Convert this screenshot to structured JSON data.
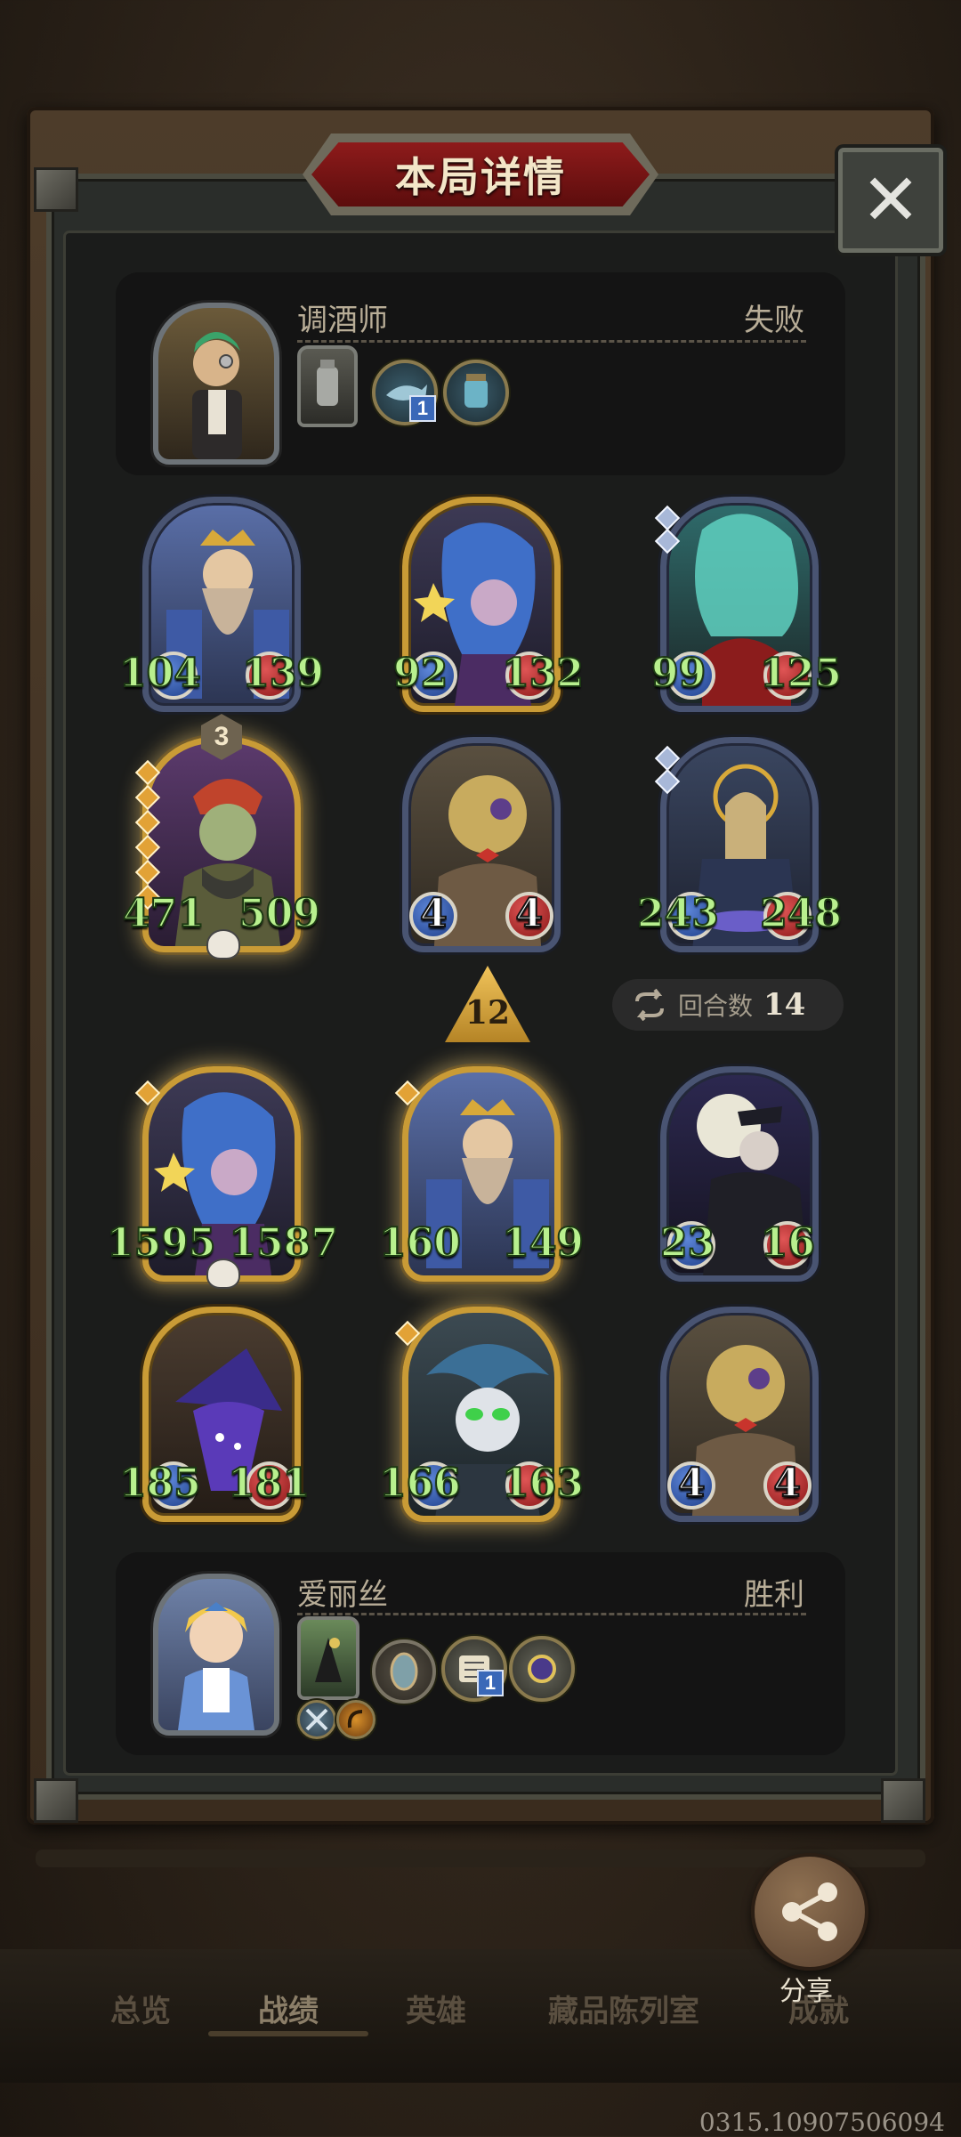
{
  "dialog": {
    "title": "本局详情"
  },
  "opponent": {
    "name": "调酒师",
    "result": "失败",
    "item_levels": [
      "1"
    ]
  },
  "opponent_board": [
    {
      "attack": "104",
      "health": "139"
    },
    {
      "attack": "92",
      "health": "132"
    },
    {
      "attack": "99",
      "health": "125"
    },
    {
      "attack": "471",
      "health": "509",
      "tier": "3"
    },
    {
      "attack": "4",
      "health": "4"
    },
    {
      "attack": "243",
      "health": "248"
    }
  ],
  "battle": {
    "turn_marker": "12",
    "rounds_label": "回合数",
    "rounds_value": "14"
  },
  "player_board": [
    {
      "attack": "1595",
      "health": "1587"
    },
    {
      "attack": "160",
      "health": "149"
    },
    {
      "attack": "23",
      "health": "16"
    },
    {
      "attack": "185",
      "health": "181"
    },
    {
      "attack": "166",
      "health": "163"
    },
    {
      "attack": "4",
      "health": "4"
    }
  ],
  "player": {
    "name": "爱丽丝",
    "result": "胜利",
    "item_levels": [
      "1"
    ]
  },
  "share": {
    "label": "分享"
  },
  "nav": {
    "items": [
      "总览",
      "战绩",
      "英雄",
      "藏品陈列室",
      "成就"
    ]
  },
  "build_id": "0315.10907506094",
  "icons": {
    "close": "close-icon",
    "share": "share-icon",
    "rounds": "swap-arrows-icon"
  },
  "colors": {
    "stat_green": "#b8f08e",
    "gold_border": "#c99b36",
    "banner_red": "#8e1b1b"
  }
}
